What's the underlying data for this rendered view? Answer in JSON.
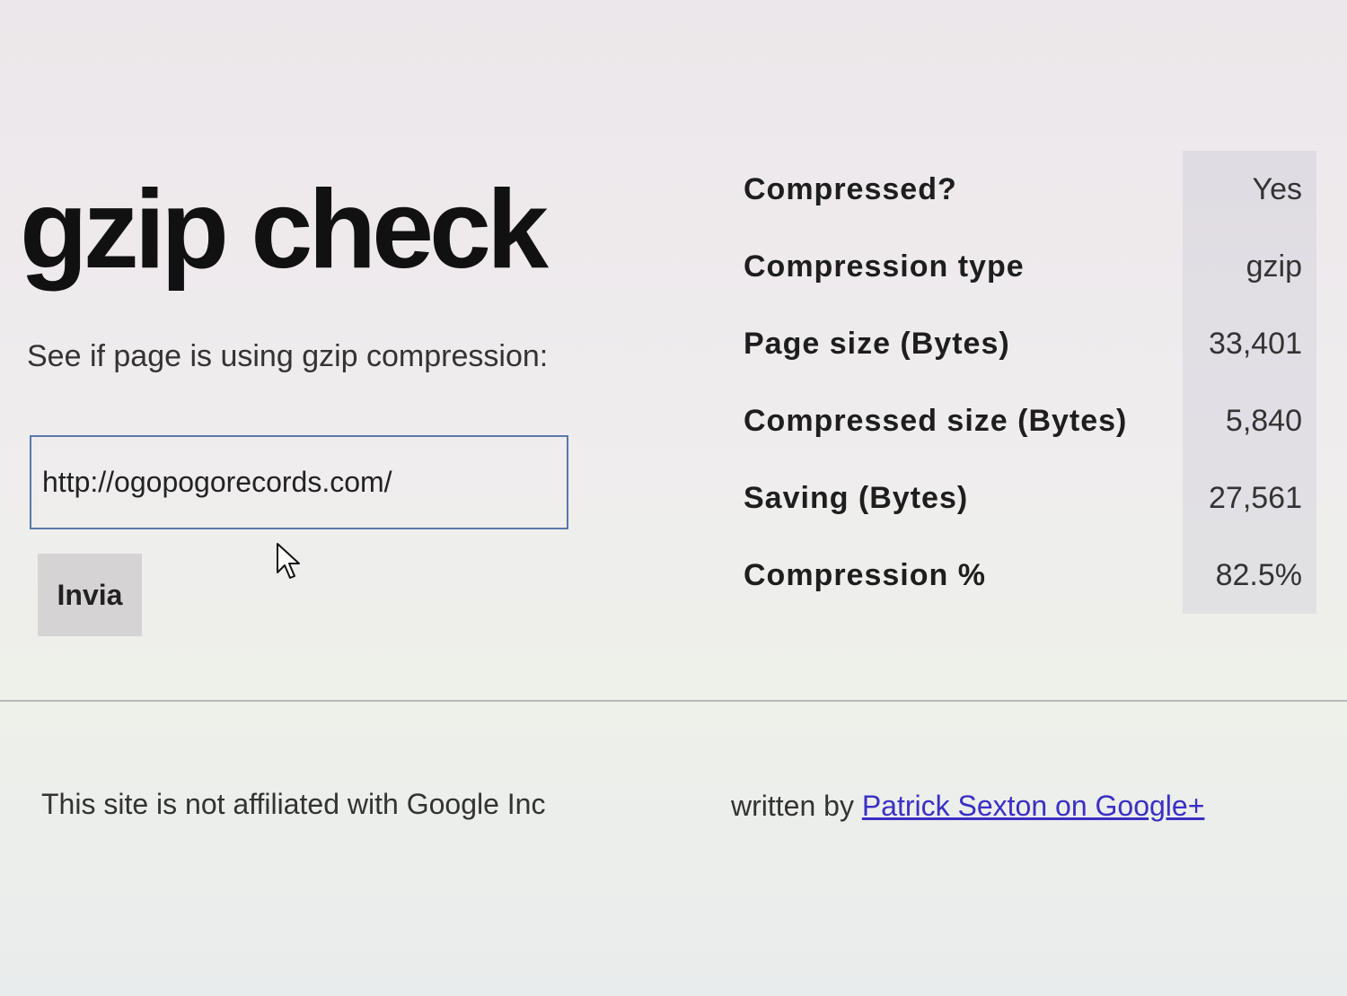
{
  "header": {
    "title": "gzip check",
    "subtitle": "See if page is using gzip compression:"
  },
  "form": {
    "url_value": "http://ogopogorecords.com/",
    "submit_label": "Invia"
  },
  "results": [
    {
      "label": "Compressed?",
      "value": "Yes"
    },
    {
      "label": "Compression type",
      "value": "gzip"
    },
    {
      "label": "Page size (Bytes)",
      "value": "33,401"
    },
    {
      "label": "Compressed size (Bytes)",
      "value": "5,840"
    },
    {
      "label": "Saving (Bytes)",
      "value": "27,561"
    },
    {
      "label": "Compression %",
      "value": "82.5%"
    }
  ],
  "footer": {
    "disclaimer": "This site is not affiliated with Google Inc",
    "credit_prefix": "written by",
    "author_link": "Patrick Sexton on Google+"
  },
  "icons": {
    "cursor": "mouse-pointer-icon"
  },
  "colors": {
    "input_border": "#5a78a8",
    "button_bg": "#d5d3d4",
    "link": "#3b2fc4"
  }
}
